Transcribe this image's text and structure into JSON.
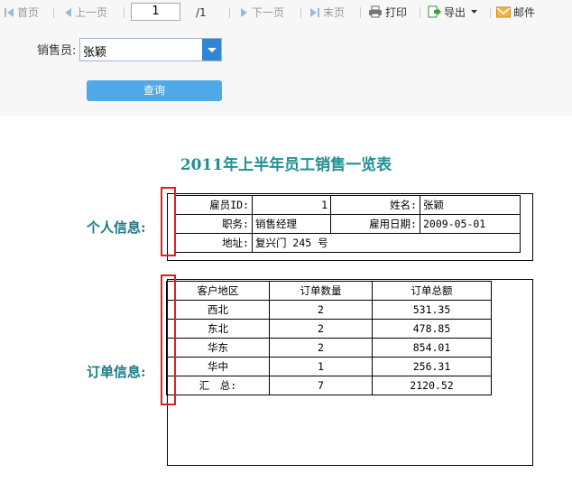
{
  "toolbar": {
    "first": "首页",
    "prev": "上一页",
    "page_value": "1",
    "page_total": "/1",
    "next": "下一页",
    "last": "末页",
    "print": "打印",
    "export": "导出",
    "email": "邮件"
  },
  "query": {
    "label": "销售员:",
    "value": "张颖",
    "button": "查询"
  },
  "report": {
    "title": "2011年上半年员工销售一览表",
    "personal_label": "个人信息:",
    "order_label": "订单信息:",
    "personal": {
      "id_label": "雇员ID:",
      "id_value": "1",
      "name_label": "姓名:",
      "name_value": "张颖",
      "title_label": "职务:",
      "title_value": "销售经理",
      "hire_label": "雇用日期:",
      "hire_value": "2009-05-01",
      "addr_label": "地址:",
      "addr_value": "复兴门 245 号"
    },
    "orders": {
      "headers": [
        "客户地区",
        "订单数量",
        "订单总额"
      ],
      "rows": [
        [
          "西北",
          "2",
          "531.35"
        ],
        [
          "东北",
          "2",
          "478.85"
        ],
        [
          "华东",
          "2",
          "854.01"
        ],
        [
          "华中",
          "1",
          "256.31"
        ]
      ],
      "total": [
        "汇　总:",
        "7",
        "2120.52"
      ]
    }
  }
}
